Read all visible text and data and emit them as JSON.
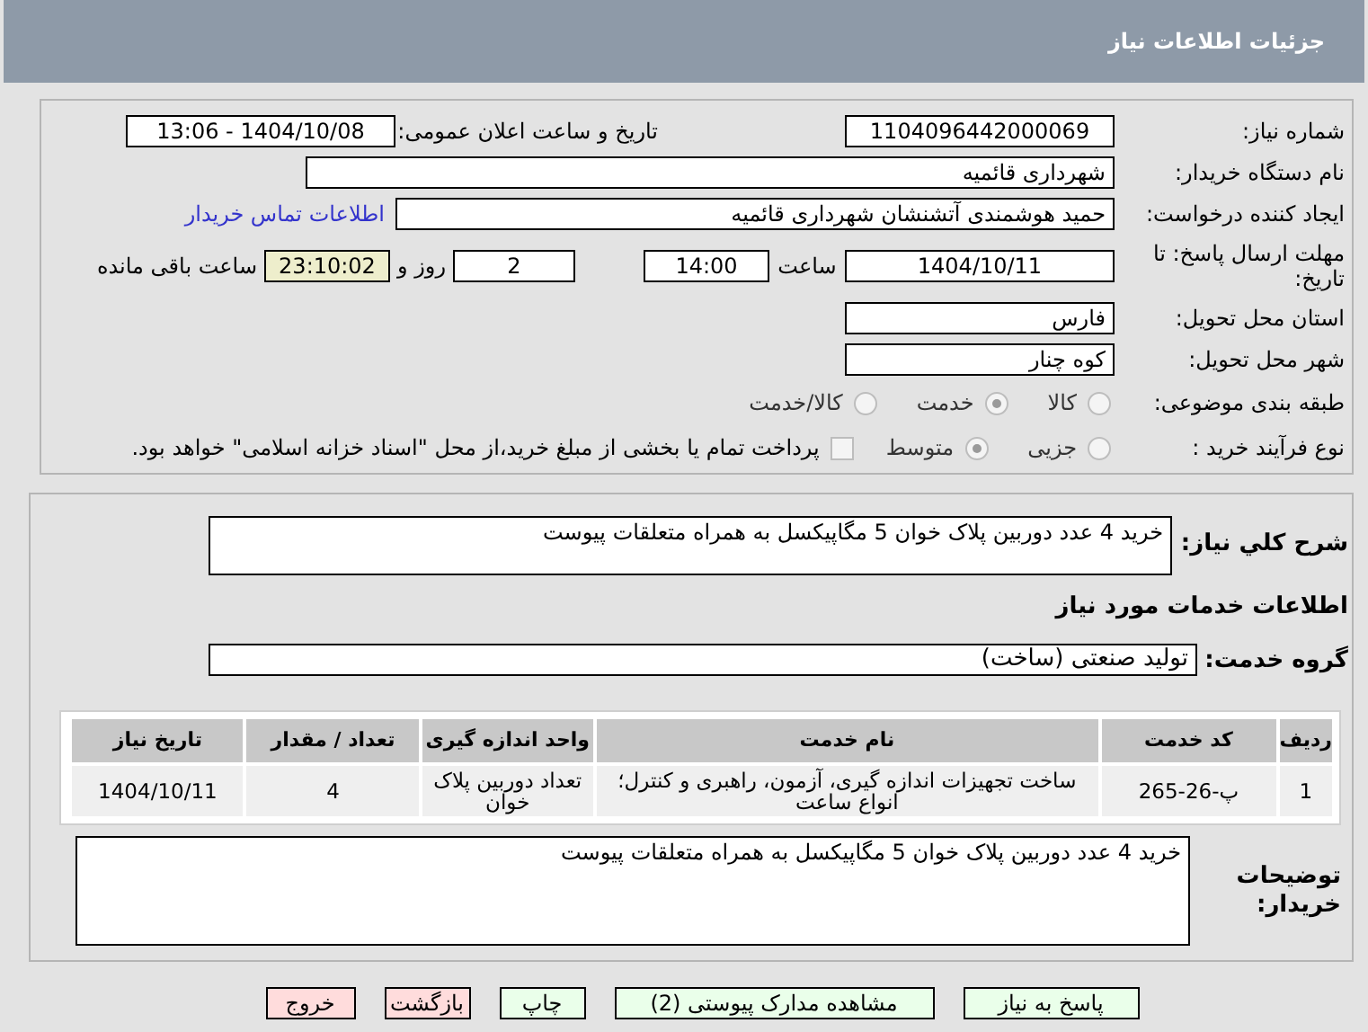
{
  "header": {
    "title": "جزئیات اطلاعات نیاز"
  },
  "need_number": {
    "label": "شماره نیاز:",
    "value": "1104096442000069"
  },
  "announce": {
    "label": "تاریخ و ساعت اعلان عمومی:",
    "value": "1404/10/08 - 13:06"
  },
  "buyer_org": {
    "label": "نام دستگاه خریدار:",
    "value": "شهرداری قائمیه"
  },
  "requester": {
    "label": "ایجاد کننده درخواست:",
    "value": "حمید هوشمندی آتشنشان شهرداری قائمیه",
    "link": "اطلاعات تماس خریدار"
  },
  "deadline": {
    "label": "مهلت ارسال پاسخ: تا تاریخ:",
    "date": "1404/10/11",
    "time_label": "ساعت",
    "time": "14:00",
    "days": "2",
    "days_label": "روز و",
    "remaining": "23:10:02",
    "remaining_label": "ساعت باقی مانده"
  },
  "province": {
    "label": "استان محل تحویل:",
    "value": "فارس"
  },
  "city": {
    "label": "شهر محل تحویل:",
    "value": "کوه چنار"
  },
  "category": {
    "label": "طبقه بندی موضوعی:",
    "options": [
      {
        "label": "کالا",
        "selected": false
      },
      {
        "label": "خدمت",
        "selected": true
      },
      {
        "label": "کالا/خدمت",
        "selected": false
      }
    ]
  },
  "purchase_type": {
    "label": "نوع فرآیند خرید :",
    "options": [
      {
        "label": "جزیی",
        "selected": false
      },
      {
        "label": "متوسط",
        "selected": true
      }
    ],
    "payment": {
      "checked": false,
      "text": "پرداخت تمام یا بخشی از مبلغ خرید،از محل \"اسناد خزانه اسلامی\" خواهد بود."
    }
  },
  "summary": {
    "label": "شرح کلي نياز:",
    "value": "خرید 4 عدد دوربین پلاک خوان 5 مگاپیکسل به همراه متعلقات پیوست"
  },
  "services_heading": "اطلاعات خدمات مورد نیاز",
  "service_group": {
    "label": "گروه خدمت:",
    "value": "تولید صنعتی (ساخت)"
  },
  "table": {
    "columns": [
      "ردیف",
      "کد خدمت",
      "نام خدمت",
      "واحد اندازه گیری",
      "تعداد / مقدار",
      "تاریخ نیاز"
    ],
    "rows": [
      [
        "1",
        "پ-26-265",
        "ساخت تجهیزات اندازه گیری، آزمون، راهبری و کنترل؛ انواع ساعت",
        "تعداد دوربین پلاک خوان",
        "4",
        "1404/10/11"
      ]
    ]
  },
  "buyer_notes": {
    "label": "توضیحات خریدار:",
    "value": "خرید 4 عدد دوربین پلاک خوان 5 مگاپیکسل به همراه متعلقات پیوست"
  },
  "buttons": [
    {
      "label": "پاسخ به نیاز",
      "kind": "primary"
    },
    {
      "label": "مشاهده مدارک پیوستی (2)",
      "kind": "primary"
    },
    {
      "label": "چاپ",
      "kind": "primary"
    },
    {
      "label": "بازگشت",
      "kind": "danger"
    },
    {
      "label": "خروج",
      "kind": "danger"
    }
  ]
}
